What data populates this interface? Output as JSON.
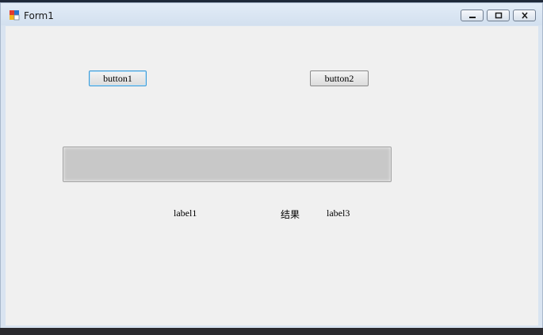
{
  "window": {
    "title": "Form1",
    "icon": "winforms-app-icon",
    "controls": {
      "minimize": "minimize-icon",
      "maximize": "maximize-icon",
      "close": "close-icon"
    }
  },
  "form": {
    "button1_label": "button1",
    "button2_label": "button2",
    "progress_value": 0,
    "label1": "label1",
    "result_caption": "结果",
    "label3": "label3"
  }
}
